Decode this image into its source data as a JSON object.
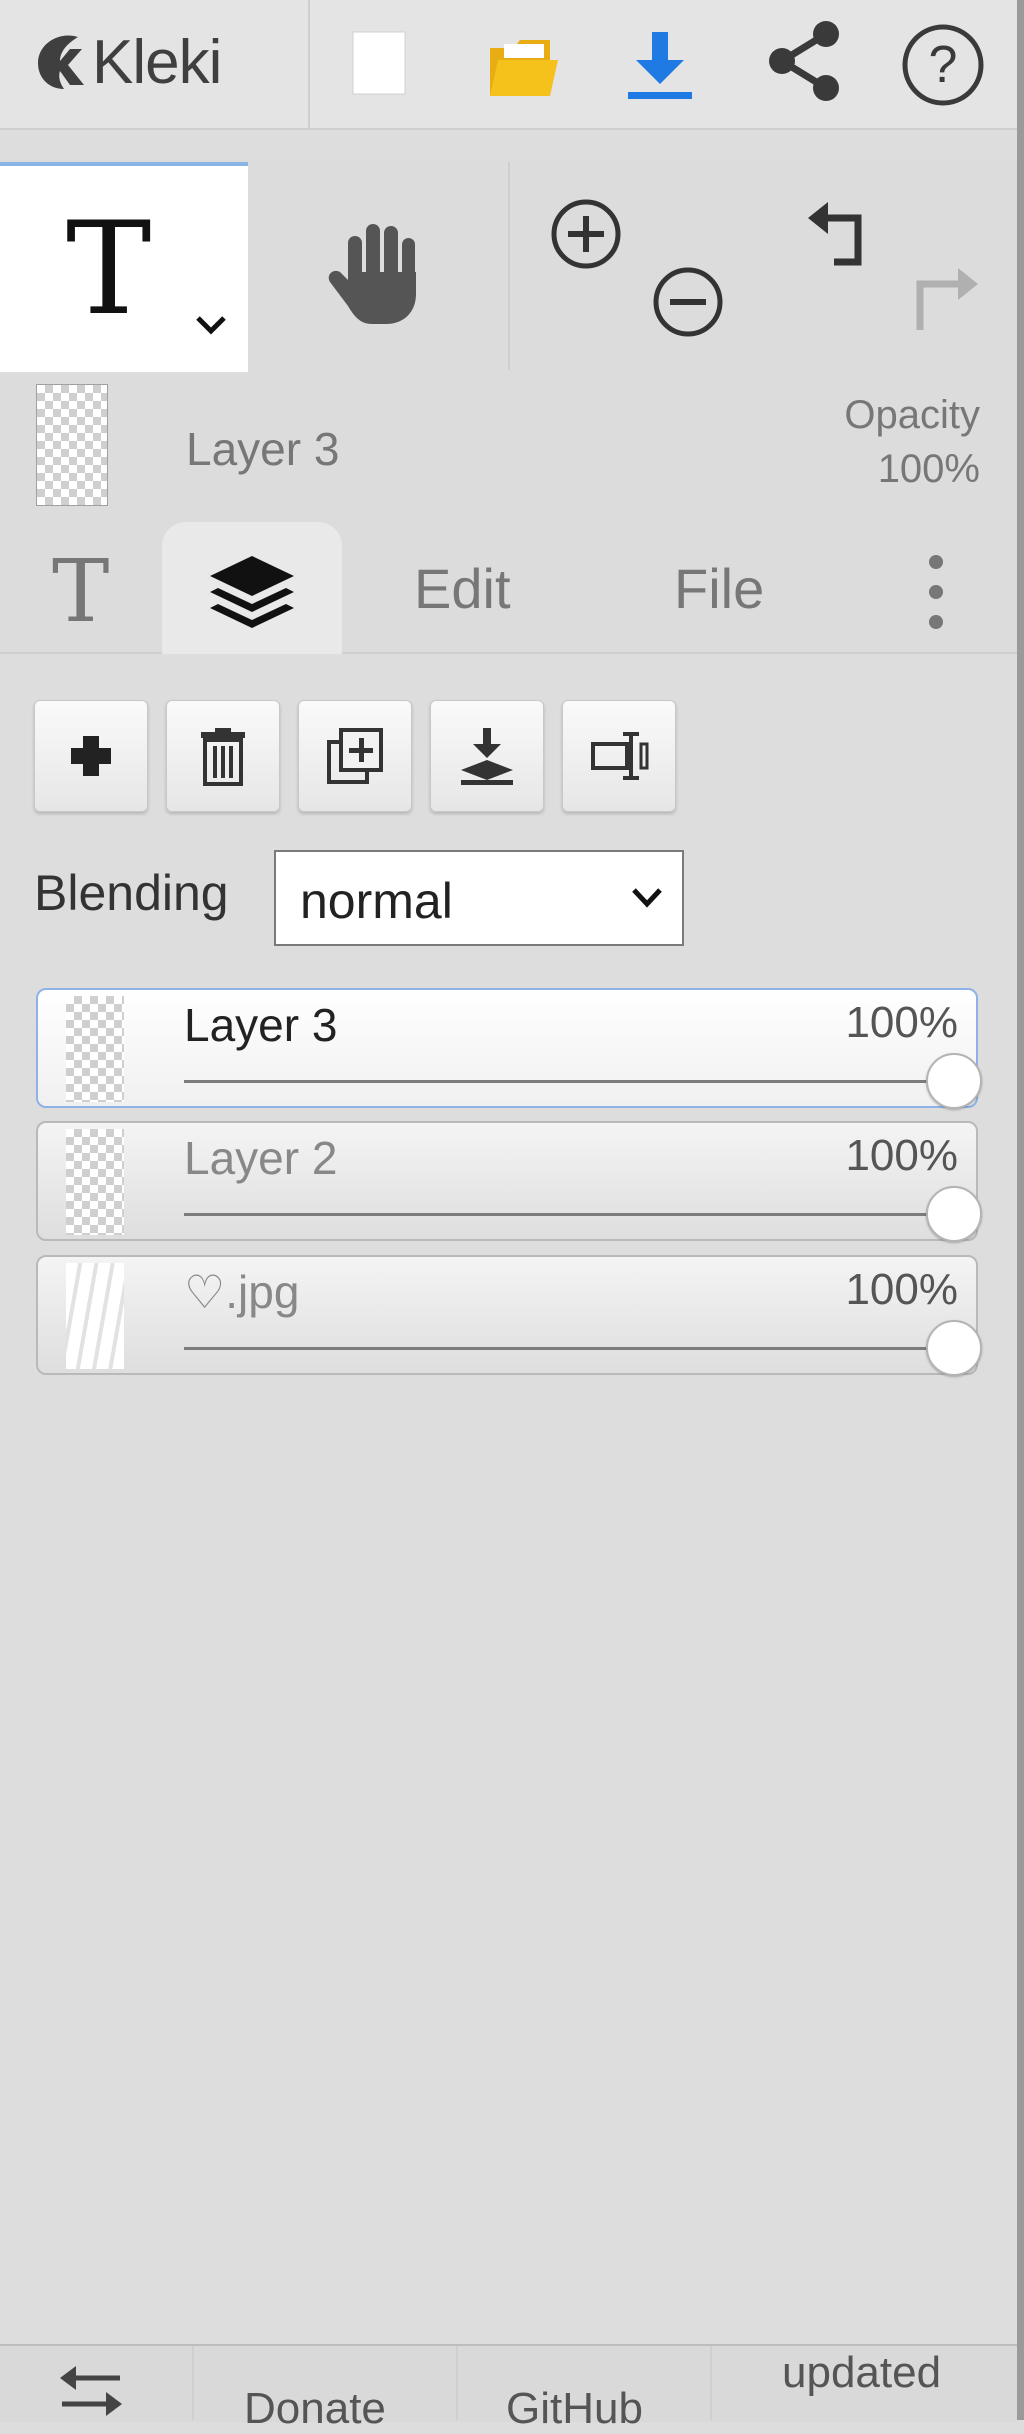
{
  "app": {
    "name": "Kleki"
  },
  "toolbar_top": {
    "icons": [
      "new-image-icon",
      "open-folder-icon",
      "download-icon",
      "share-icon",
      "help-icon"
    ],
    "colors": {
      "folder": "#f5c21b",
      "download": "#1f7be3",
      "icon": "#3a3a3a"
    }
  },
  "tools": {
    "active_tool_glyph": "T",
    "icons": [
      "text-tool-icon",
      "hand-tool-icon",
      "zoom-in-icon",
      "zoom-out-icon",
      "undo-icon",
      "redo-icon"
    ]
  },
  "layer_info": {
    "name": "Layer 3",
    "opacity_label": "Opacity",
    "opacity_value": "100%"
  },
  "tabs": [
    {
      "label": "T",
      "icon": "text-tab-icon"
    },
    {
      "label": "",
      "icon": "layers-icon",
      "active": true
    },
    {
      "label": "Edit"
    },
    {
      "label": "File"
    },
    {
      "label": "",
      "icon": "more-vertical-icon"
    }
  ],
  "layer_panel": {
    "buttons": [
      "add-layer-icon",
      "delete-layer-icon",
      "duplicate-layer-icon",
      "merge-down-icon",
      "rename-layer-icon"
    ],
    "blending_label": "Blending",
    "blending_value": "normal",
    "layers": [
      {
        "name": "Layer 3",
        "opacity_label": "100%",
        "opacity": 1.0,
        "selected": true
      },
      {
        "name": "Layer 2",
        "opacity_label": "100%",
        "opacity": 1.0,
        "selected": false
      },
      {
        "name": "♡.jpg",
        "opacity_label": "100%",
        "opacity": 1.0,
        "selected": false
      }
    ]
  },
  "bottom_bar": {
    "back_icon": "swap-arrows-icon",
    "donate_label": "Donate",
    "github_label": "GitHub",
    "updated_label": "updated"
  },
  "colors": {
    "panel_bg": "#dddddd",
    "selected_border": "#8eb2e8",
    "accent_blue": "#1f7be3"
  }
}
